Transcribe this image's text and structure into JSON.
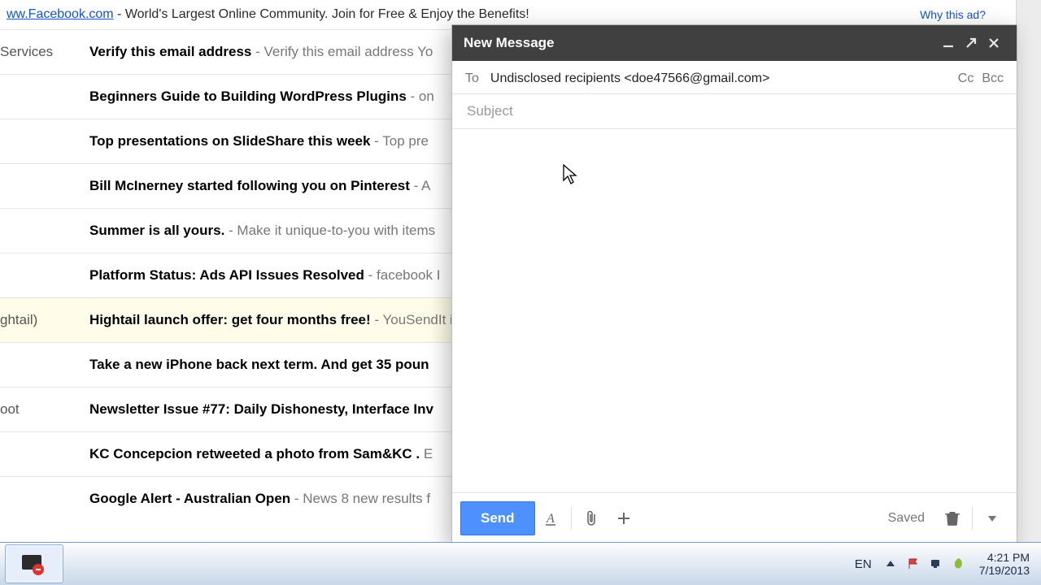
{
  "ad": {
    "link_text": "ww.Facebook.com",
    "rest": " - World's Largest Online Community. Join for Free & Enjoy the Benefits!",
    "why": "Why this ad?"
  },
  "emails": [
    {
      "sender": "Services",
      "subject": "Verify this email address",
      "preview": " - Verify this email address Yo",
      "selected": false
    },
    {
      "sender": "",
      "subject": "Beginners Guide to Building WordPress Plugins",
      "preview": " - on",
      "selected": false
    },
    {
      "sender": "",
      "subject": "Top presentations on SlideShare this week",
      "preview": " - Top pre",
      "selected": false
    },
    {
      "sender": "",
      "subject": "Bill McInerney started following you on Pinterest",
      "preview": " - A",
      "selected": false
    },
    {
      "sender": "",
      "subject": "Summer is all yours.",
      "preview": " - Make it unique-to-you with items",
      "selected": false
    },
    {
      "sender": "",
      "subject": "Platform Status: Ads API Issues Resolved",
      "preview": " - facebook I",
      "selected": false
    },
    {
      "sender": "ghtail)",
      "subject": "Hightail launch offer: get four months free!",
      "preview": " - YouSendIt is",
      "selected": true
    },
    {
      "sender": "",
      "subject": "Take a new iPhone back next term. And get 35 poun",
      "preview": "",
      "selected": false
    },
    {
      "sender": "oot",
      "subject": "Newsletter Issue #77: Daily Dishonesty, Interface Inv",
      "preview": "",
      "selected": false
    },
    {
      "sender": "",
      "subject": "KC Concepcion retweeted a photo from Sam&KC .",
      "preview": " E",
      "selected": false
    },
    {
      "sender": "",
      "subject": "Google Alert - Australian Open",
      "preview": " - News 8 new results f",
      "selected": false
    }
  ],
  "compose": {
    "title": "New Message",
    "to_label": "To",
    "to_value": "Undisclosed recipients <doe47566@gmail.com>",
    "cc": "Cc",
    "bcc": "Bcc",
    "subject_placeholder": "Subject",
    "subject_value": "",
    "send": "Send",
    "saved": "Saved"
  },
  "taskbar": {
    "lang": "EN",
    "time": "4:21 PM",
    "date": "7/19/2013"
  }
}
